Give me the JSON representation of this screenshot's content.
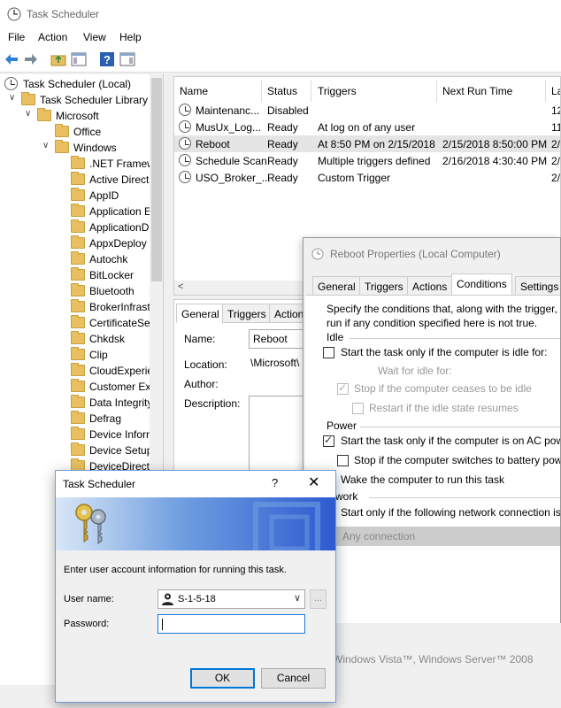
{
  "window": {
    "title": "Task Scheduler"
  },
  "menu": [
    "File",
    "Action",
    "View",
    "Help"
  ],
  "tree": {
    "root": "Task Scheduler (Local)",
    "library": "Task Scheduler Library",
    "microsoft": "Microsoft",
    "office": "Office",
    "windows": "Windows",
    "folders": [
      ".NET Framew",
      "Active Direct",
      "AppID",
      "Application E",
      "ApplicationD",
      "AppxDeploy",
      "Autochk",
      "BitLocker",
      "Bluetooth",
      "BrokerInfrast",
      "CertificateSe",
      "Chkdsk",
      "Clip",
      "CloudExperie",
      "Customer Ex",
      "Data Integrity",
      "Defrag",
      "Device Inforr",
      "Device Setup",
      "DeviceDirect"
    ]
  },
  "task_list": {
    "columns": [
      "Name",
      "Status",
      "Triggers",
      "Next Run Time",
      "La"
    ],
    "rows": [
      {
        "name": "Maintenanc...",
        "status": "Disabled",
        "triggers": "",
        "next_run": "",
        "last": "12"
      },
      {
        "name": "MusUx_Log...",
        "status": "Ready",
        "triggers": "At log on of any user",
        "next_run": "",
        "last": "11"
      },
      {
        "name": "Reboot",
        "status": "Ready",
        "triggers": "At 8:50 PM on 2/15/2018",
        "next_run": "2/15/2018 8:50:00 PM",
        "last": "2/"
      },
      {
        "name": "Schedule Scan",
        "status": "Ready",
        "triggers": "Multiple triggers defined",
        "next_run": "2/16/2018 4:30:40 PM",
        "last": "2/"
      },
      {
        "name": "USO_Broker_...",
        "status": "Ready",
        "triggers": "Custom Trigger",
        "next_run": "",
        "last": "2/"
      }
    ]
  },
  "detail": {
    "tabs": [
      "General",
      "Triggers",
      "Action"
    ],
    "name_label": "Name:",
    "name_value": "Reboot",
    "location_label": "Location:",
    "location_value": "\\Microsoft\\",
    "author_label": "Author:",
    "description_label": "Description:"
  },
  "properties": {
    "title": "Reboot Properties (Local Computer)",
    "tabs": [
      "General",
      "Triggers",
      "Actions",
      "Conditions",
      "Settings"
    ],
    "intro_line1": "Specify the conditions that, along with the trigger,",
    "intro_line2": "run  if any condition specified here is not true.",
    "idle_group": "Idle",
    "idle_start": "Start the task only if the computer is idle for:",
    "wait_idle": "Wait for idle for:",
    "stop_idle": "Stop if the computer ceases to be idle",
    "restart_idle": "Restart if the idle state resumes",
    "power_group": "Power",
    "power_ac": "Start the task only if the computer is on AC pow",
    "power_battery": "Stop if the computer switches to battery pow",
    "wake": "Wake the computer to run this task",
    "network_group": "etwork",
    "network_start": "Start only if the following network connection is",
    "any_connection": "Any connection",
    "os_text": "Windows Vista™, Windows Server™ 2008"
  },
  "login": {
    "title": "Task Scheduler",
    "help": "?",
    "close": "✕",
    "message": "Enter user account information for running this task.",
    "user_label": "User name:",
    "user_value": "S-1-5-18",
    "browse": "...",
    "password_label": "Password:",
    "ok": "OK",
    "cancel": "Cancel"
  }
}
